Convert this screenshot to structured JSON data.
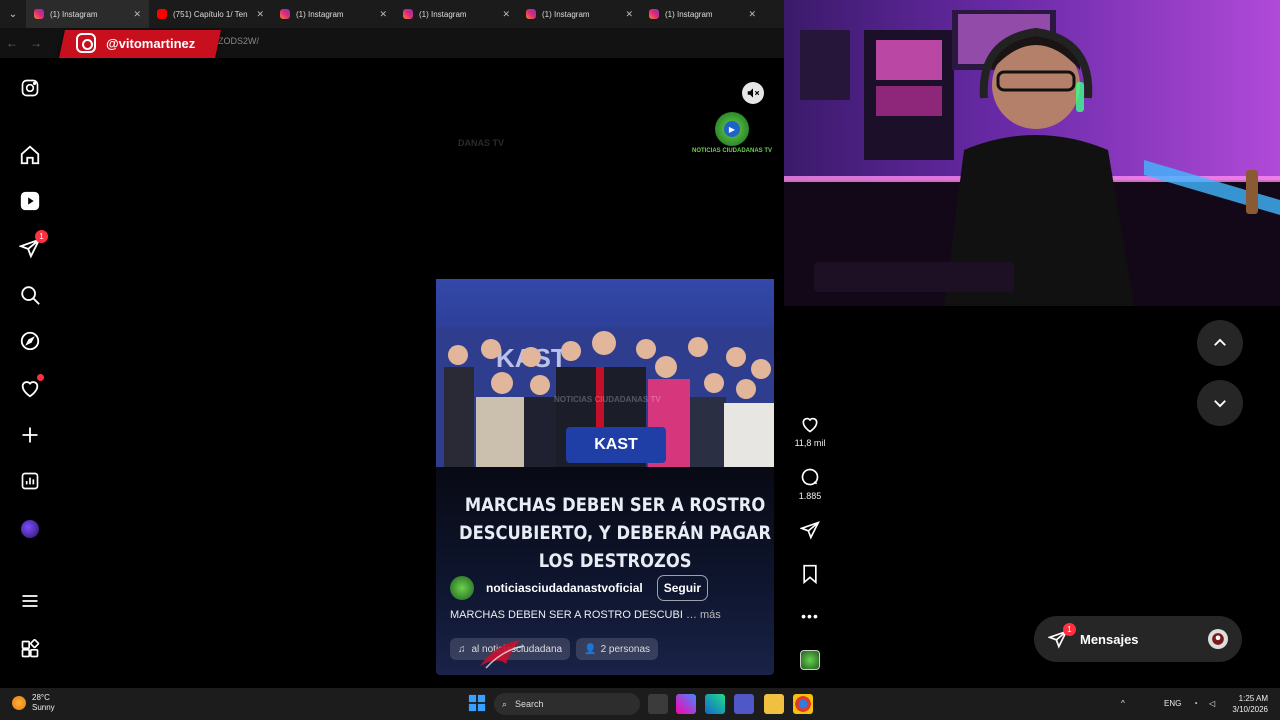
{
  "browser": {
    "tabs": [
      {
        "title": "(1) Instagram",
        "favicon": "instagram-icon",
        "active": true
      },
      {
        "title": "(751) Capítulo 1/ Ten",
        "favicon": "youtube-icon",
        "active": false
      },
      {
        "title": "(1) Instagram",
        "favicon": "instagram-icon",
        "active": false
      },
      {
        "title": "(1) Instagram",
        "favicon": "instagram-icon",
        "active": false
      },
      {
        "title": "(1) Instagram",
        "favicon": "instagram-icon",
        "active": false
      },
      {
        "title": "(1) Instagram",
        "favicon": "instagram-icon",
        "active": false
      }
    ],
    "url_fragment": "ZODS2W/"
  },
  "stream_overlay": {
    "handle": "@vitomartinez"
  },
  "sidebar": {
    "items": [
      {
        "name": "instagram-logo",
        "icon": "instagram-icon"
      },
      {
        "name": "home",
        "icon": "home-icon"
      },
      {
        "name": "reels",
        "icon": "reels-icon"
      },
      {
        "name": "messages",
        "icon": "send-icon",
        "badge": "1"
      },
      {
        "name": "search",
        "icon": "search-icon"
      },
      {
        "name": "explore",
        "icon": "compass-icon"
      },
      {
        "name": "notifications",
        "icon": "heart-icon",
        "dot": true
      },
      {
        "name": "create",
        "icon": "plus-icon"
      },
      {
        "name": "dashboard",
        "icon": "chart-icon"
      },
      {
        "name": "profile",
        "icon": "avatar"
      },
      {
        "name": "more",
        "icon": "menu-icon"
      },
      {
        "name": "also-from-meta",
        "icon": "apps-icon"
      }
    ]
  },
  "reel": {
    "watermark_left": "DANAS TV",
    "channel_logo_text": "NOTICIAS CIUDADANAS TV",
    "photo_watermark": "NOTICIAS CIUDADANAS TV",
    "podium_label": "KAST",
    "headline": "MARCHAS DEBEN SER A ROSTRO DESCUBIERTO, Y DEBERÁN PAGAR LOS DESTROZOS",
    "author": "noticiasciudadanastvoficial",
    "follow_label": "Seguir",
    "caption": "MARCHAS DEBEN SER A ROSTRO DESCUBI",
    "caption_more": "… más",
    "audio_label": "al  noticiasciudadana",
    "people_label": "2 personas"
  },
  "actions": {
    "likes": "11,8 mil",
    "comments": "1.885"
  },
  "messages": {
    "label": "Mensajes",
    "badge": "1"
  },
  "taskbar": {
    "temperature": "28°C",
    "condition": "Sunny",
    "search_placeholder": "Search",
    "language": "ENG",
    "time": "1:25 AM",
    "date": "3/10/2026"
  },
  "colors": {
    "accent_red": "#ff3040",
    "badge_red": "#c80f1e",
    "background": "#000000"
  }
}
